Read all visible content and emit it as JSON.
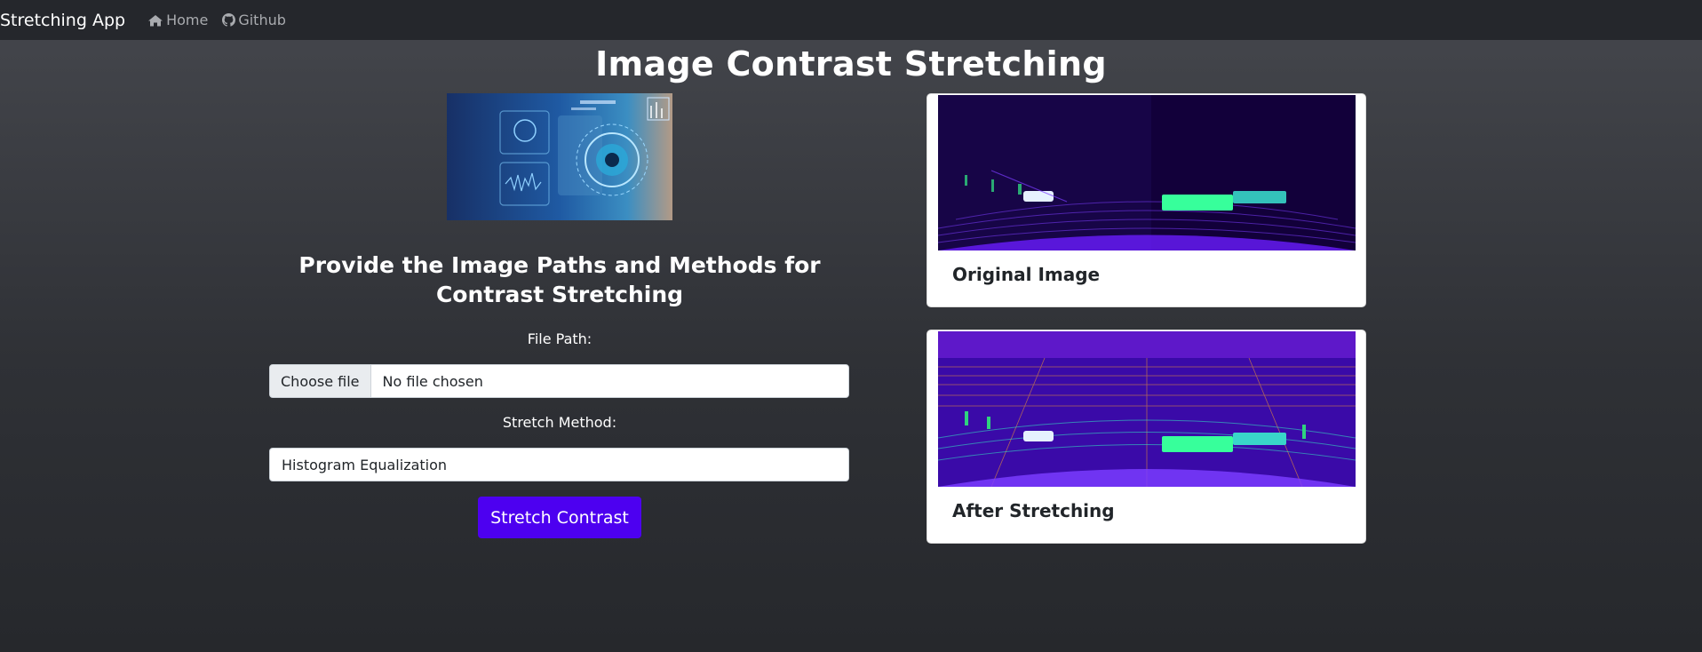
{
  "navbar": {
    "brand": "Stretching App",
    "links": [
      {
        "label": "Home",
        "icon": "home-icon"
      },
      {
        "label": "Github",
        "icon": "github-icon"
      }
    ]
  },
  "page_title": "Image Contrast Stretching",
  "form": {
    "heading": "Provide the Image Paths and Methods for Contrast Stretching",
    "file_label": "File Path:",
    "file_button": "Choose file",
    "file_status": "No file chosen",
    "method_label": "Stretch Method:",
    "method_value": "Histogram Equalization",
    "submit_label": "Stretch Contrast"
  },
  "cards": {
    "original_title": "Original Image",
    "after_title": "After Stretching"
  },
  "colors": {
    "accent": "#4d00f0",
    "navbar": "#25272c"
  }
}
